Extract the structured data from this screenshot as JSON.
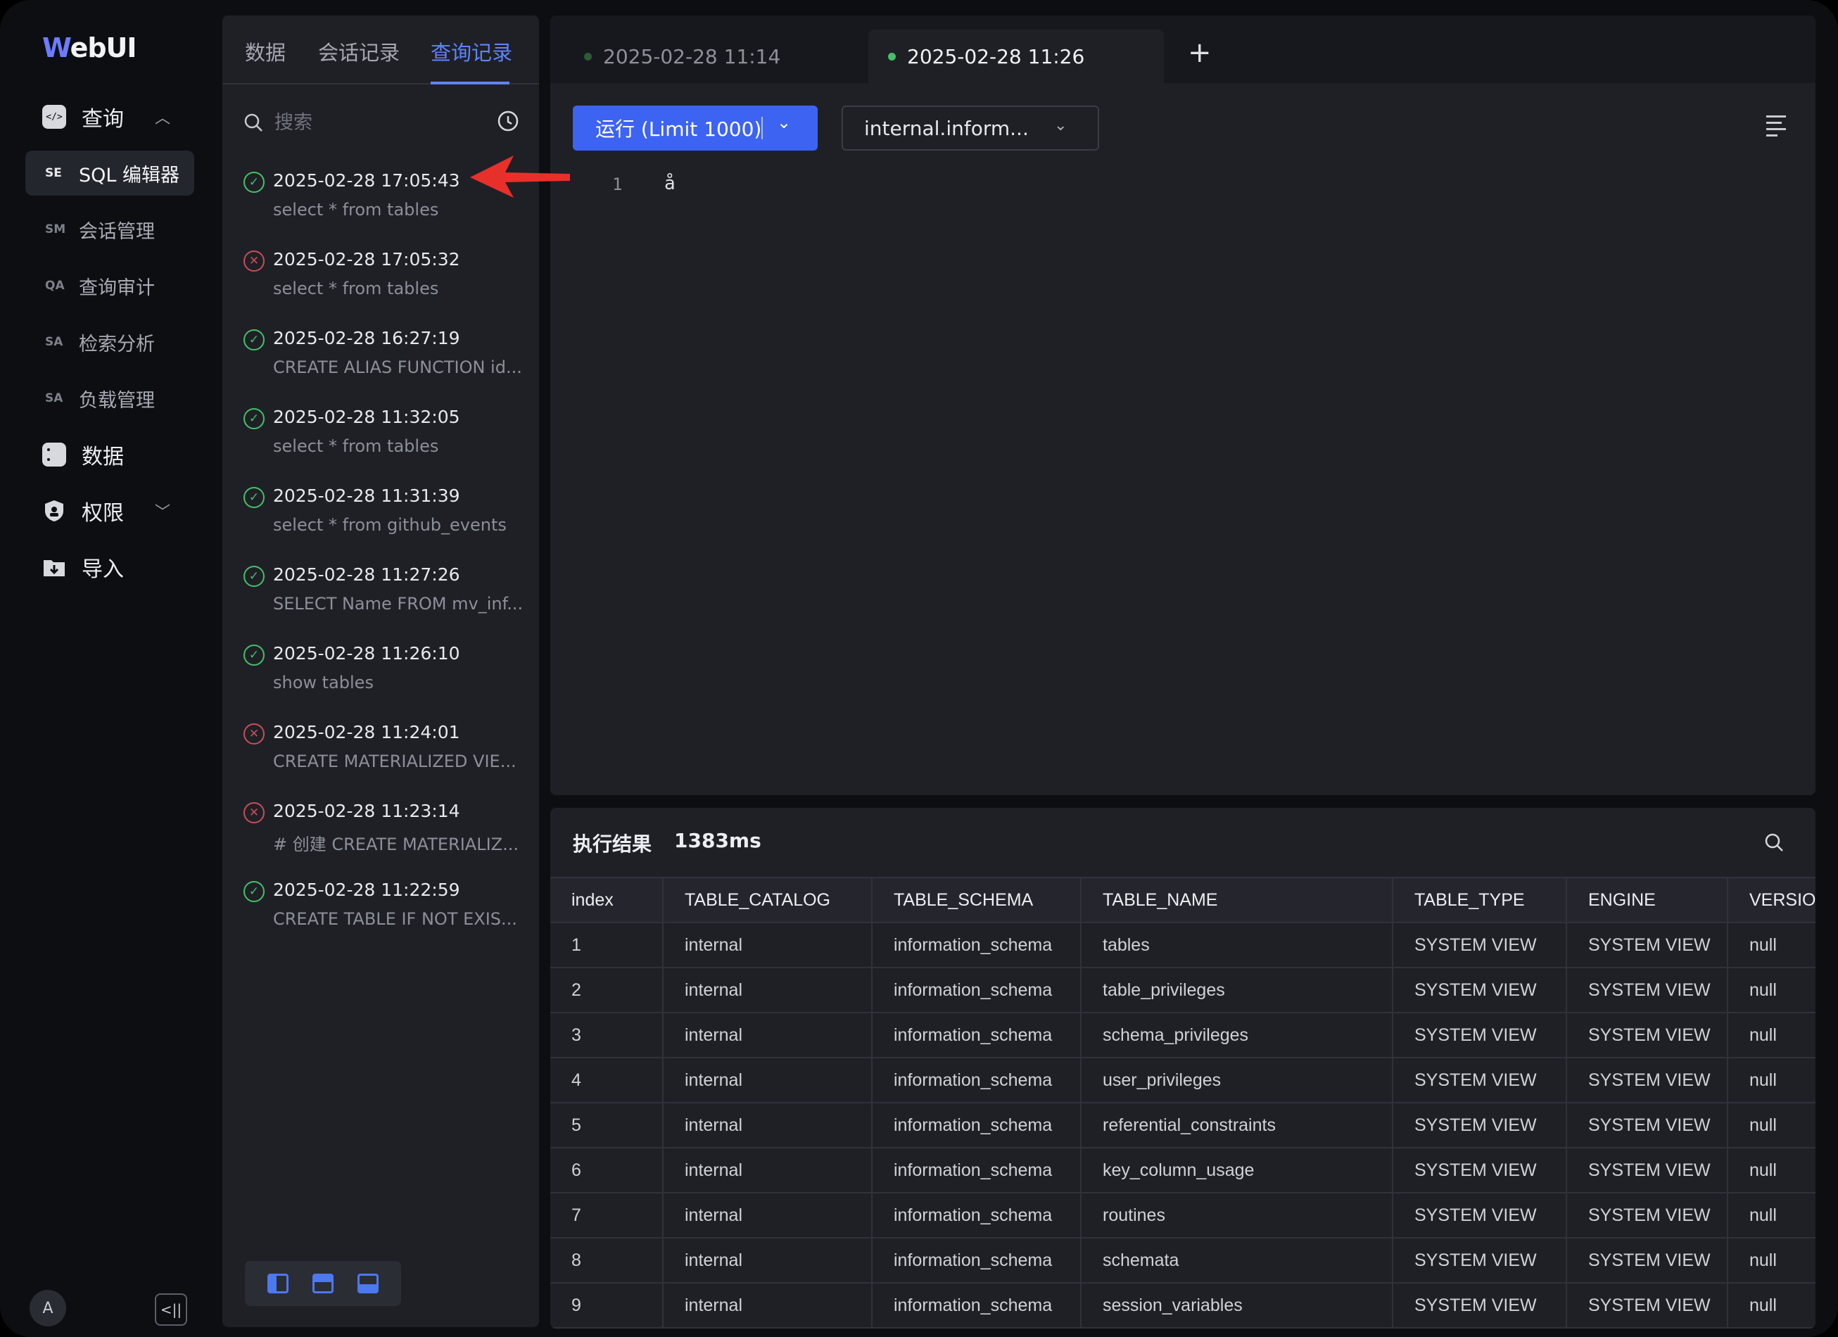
{
  "app": {
    "logo_first": "W",
    "logo_rest": "ebUI"
  },
  "sidebar": {
    "groups": [
      {
        "label": "查询",
        "icon": "code-chat-icon",
        "expanded": true
      },
      {
        "label": "数据",
        "icon": "database-icon"
      },
      {
        "label": "权限",
        "icon": "shield-icon",
        "expanded": false
      },
      {
        "label": "导入",
        "icon": "folder-import-icon"
      }
    ],
    "items": [
      {
        "abbr": "SE",
        "label": "SQL 编辑器",
        "active": true
      },
      {
        "abbr": "SM",
        "label": "会话管理"
      },
      {
        "abbr": "QA",
        "label": "查询审计"
      },
      {
        "abbr": "SA",
        "label": "检索分析"
      },
      {
        "abbr": "SA",
        "label": "负载管理"
      }
    ],
    "avatar": "A"
  },
  "history_panel": {
    "tabs": [
      "数据",
      "会话记录",
      "查询记录"
    ],
    "active_tab": 2,
    "search_placeholder": "搜索",
    "items": [
      {
        "time": "2025-02-28 17:05:43",
        "sql": "select * from tables",
        "status": "success"
      },
      {
        "time": "2025-02-28 17:05:32",
        "sql": "select * from tables",
        "status": "error"
      },
      {
        "time": "2025-02-28 16:27:19",
        "sql": "CREATE ALIAS FUNCTION id...",
        "status": "success"
      },
      {
        "time": "2025-02-28 11:32:05",
        "sql": "select * from tables",
        "status": "success"
      },
      {
        "time": "2025-02-28 11:31:39",
        "sql": "select * from github_events",
        "status": "success"
      },
      {
        "time": "2025-02-28 11:27:26",
        "sql": "SELECT Name FROM mv_inf...",
        "status": "success"
      },
      {
        "time": "2025-02-28 11:26:10",
        "sql": "show tables",
        "status": "success"
      },
      {
        "time": "2025-02-28 11:24:01",
        "sql": "CREATE MATERIALIZED VIE...",
        "status": "error"
      },
      {
        "time": "2025-02-28 11:23:14",
        "sql": "# 创建 CREATE MATERIALIZ...",
        "status": "error"
      },
      {
        "time": "2025-02-28 11:22:59",
        "sql": "CREATE TABLE IF NOT EXIS...",
        "status": "success"
      }
    ]
  },
  "editor": {
    "tabs": [
      {
        "label": "2025-02-28 11:14",
        "active": false,
        "dot_color": "#2f5a36"
      },
      {
        "label": "2025-02-28 11:26",
        "active": true,
        "dot_color": "#45c068"
      }
    ],
    "add_tab": "+",
    "run_label": "运行 (Limit 1000)",
    "db_select": "internal.inform...",
    "lines": [
      {
        "no": "1",
        "text": "å"
      }
    ]
  },
  "results": {
    "title": "执行结果",
    "duration": "1383ms",
    "columns": [
      "index",
      "TABLE_CATALOG",
      "TABLE_SCHEMA",
      "TABLE_NAME",
      "TABLE_TYPE",
      "ENGINE",
      "VERSION"
    ],
    "rows": [
      [
        "1",
        "internal",
        "information_schema",
        "tables",
        "SYSTEM VIEW",
        "SYSTEM VIEW",
        "null"
      ],
      [
        "2",
        "internal",
        "information_schema",
        "table_privileges",
        "SYSTEM VIEW",
        "SYSTEM VIEW",
        "null"
      ],
      [
        "3",
        "internal",
        "information_schema",
        "schema_privileges",
        "SYSTEM VIEW",
        "SYSTEM VIEW",
        "null"
      ],
      [
        "4",
        "internal",
        "information_schema",
        "user_privileges",
        "SYSTEM VIEW",
        "SYSTEM VIEW",
        "null"
      ],
      [
        "5",
        "internal",
        "information_schema",
        "referential_constraints",
        "SYSTEM VIEW",
        "SYSTEM VIEW",
        "null"
      ],
      [
        "6",
        "internal",
        "information_schema",
        "key_column_usage",
        "SYSTEM VIEW",
        "SYSTEM VIEW",
        "null"
      ],
      [
        "7",
        "internal",
        "information_schema",
        "routines",
        "SYSTEM VIEW",
        "SYSTEM VIEW",
        "null"
      ],
      [
        "8",
        "internal",
        "information_schema",
        "schemata",
        "SYSTEM VIEW",
        "SYSTEM VIEW",
        "null"
      ],
      [
        "9",
        "internal",
        "information_schema",
        "session_variables",
        "SYSTEM VIEW",
        "SYSTEM VIEW",
        "null"
      ]
    ]
  },
  "colors": {
    "accent": "#3d63f2",
    "success": "#45c068",
    "error": "#c84e55",
    "annotation_arrow": "#e8302a"
  }
}
